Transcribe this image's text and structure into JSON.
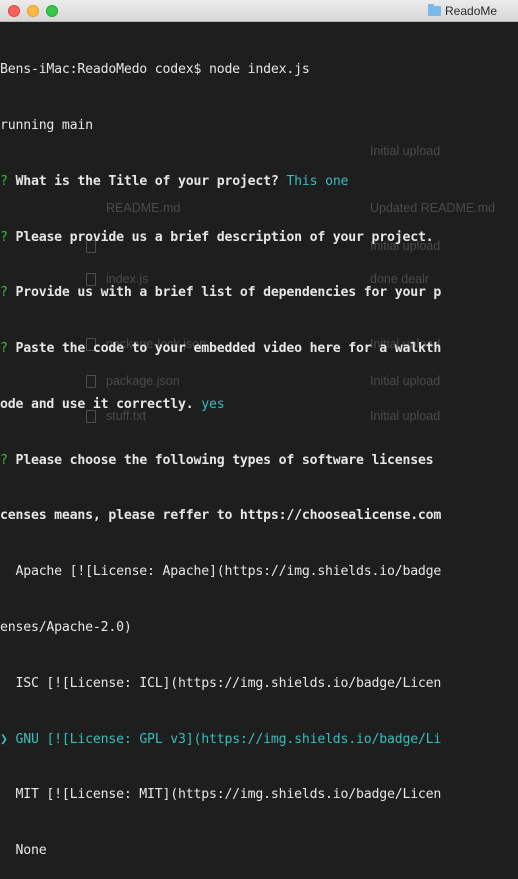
{
  "window": {
    "title": "ReadoMe"
  },
  "background_files": [
    {
      "name": "",
      "message": "Initial upload"
    },
    {
      "name": "README.md",
      "message": "Updated README.md"
    },
    {
      "name": "",
      "message": "Initial upload"
    },
    {
      "name": "index.js",
      "message": "done dealr"
    },
    {
      "name": "package-lock.json",
      "message": "Initial upload"
    },
    {
      "name": "package.json",
      "message": "Initial upload"
    },
    {
      "name": "stuff.txt",
      "message": "Initial upload"
    }
  ],
  "terminal": {
    "prompt": "Bens-iMac:ReadoMedo codex$ node index.js",
    "running": "running main",
    "q1": {
      "mark": "?",
      "text": " What is the Title of your project?",
      "answer": " This one"
    },
    "q2": {
      "mark": "?",
      "text": " Please provide us a brief description of your project."
    },
    "q3": {
      "mark": "?",
      "text": " Provide us with a brief list of dependencies for your p"
    },
    "q4": {
      "mark": "?",
      "text": " Paste the code to your embedded video here for a walkth"
    },
    "q4_cont": "ode and use it correctly.",
    "q4_answer": " yes",
    "q5": {
      "mark": "?",
      "text": " Please choose the following types of software licenses"
    },
    "q5_cont": "censes means, please reffer to https://choosealicense.com",
    "options": {
      "apache_1": "  Apache [![License: Apache](https://img.shields.io/badge",
      "apache_2": "enses/Apache-2.0)",
      "isc": "  ISC [![License: ICL](https://img.shields.io/badge/Licen",
      "gnu_pointer": "❯",
      "gnu": " GNU [![License: GPL v3](https://img.shields.io/badge/Li",
      "mit": "  MIT [![License: MIT](https://img.shields.io/badge/Licen",
      "none": "  None"
    }
  }
}
